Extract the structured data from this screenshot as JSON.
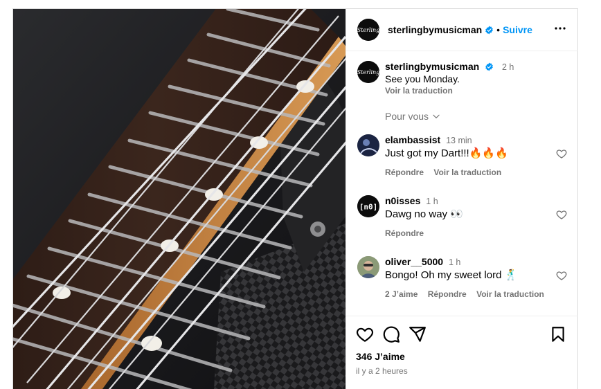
{
  "post": {
    "username": "sterlingbymusicman",
    "follow_label": "Suivre",
    "dot": "•",
    "caption": {
      "username": "sterlingbymusicman",
      "time": "2 h",
      "text": "See you Monday.",
      "translate_label": "Voir la traduction"
    },
    "pour_vous_label": "Pour vous",
    "comments": [
      {
        "username": "elambassist",
        "time": "13 min",
        "text": "Just got my Dart!!!🔥🔥🔥",
        "reply_label": "Répondre",
        "translate_label": "Voir la traduction"
      },
      {
        "username": "n0isses",
        "time": "1 h",
        "text": "Dawg no way 👀",
        "reply_label": "Répondre"
      },
      {
        "username": "oliver__5000",
        "time": "1 h",
        "text": "Bongo! Oh my sweet lord 🕺",
        "likes_label": "2 J’aime",
        "reply_label": "Répondre",
        "translate_label": "Voir la traduction"
      }
    ],
    "avatar_texts": {
      "brand": "Sterling",
      "n0isses": "[n0]"
    },
    "likes": "346 J’aime",
    "timestamp": "il y a 2 heures"
  },
  "colors": {
    "link": "#0095f6",
    "secondary_text": "#737373",
    "verified": "#0095f6",
    "divider": "#efefef"
  },
  "icons": [
    "verified-badge-icon",
    "more-options-icon",
    "chevron-down-icon",
    "heart-icon",
    "comment-icon",
    "share-icon",
    "bookmark-icon"
  ]
}
